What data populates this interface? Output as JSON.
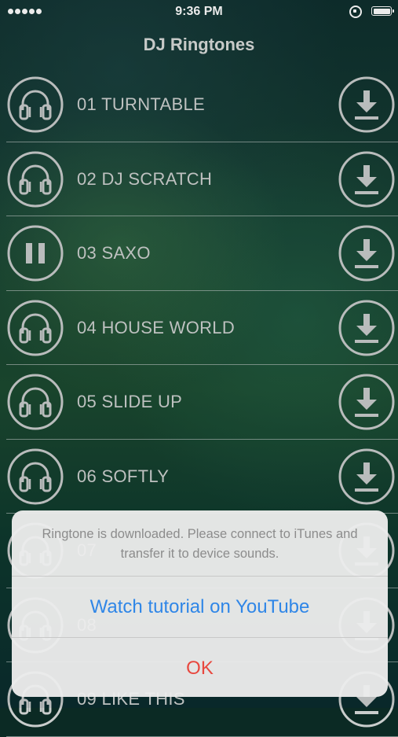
{
  "status_bar": {
    "time": "9:36 PM"
  },
  "nav": {
    "title": "DJ Ringtones"
  },
  "list": {
    "items": [
      {
        "label": "01 TURNTABLE",
        "state": "headphones"
      },
      {
        "label": "02 DJ SCRATCH",
        "state": "headphones"
      },
      {
        "label": "03 SAXO",
        "state": "pause"
      },
      {
        "label": "04 HOUSE WORLD",
        "state": "headphones"
      },
      {
        "label": "05 SLIDE UP",
        "state": "headphones"
      },
      {
        "label": "06 SOFTLY",
        "state": "headphones"
      },
      {
        "label": "07",
        "state": "headphones"
      },
      {
        "label": "08",
        "state": "headphones"
      },
      {
        "label": "09 LIKE THIS",
        "state": "headphones"
      }
    ]
  },
  "alert": {
    "message": "Ringtone is downloaded. Please connect to iTunes and transfer it to device sounds.",
    "youtube_label": "Watch tutorial on YouTube",
    "ok_label": "OK"
  },
  "colors": {
    "icon_stroke": "#c9cdcc",
    "alert_link": "#2f86e7",
    "alert_ok": "#e8473e"
  },
  "icons": {
    "play_state": [
      "headphones-icon",
      "pause-icon"
    ],
    "download": "download-icon"
  }
}
